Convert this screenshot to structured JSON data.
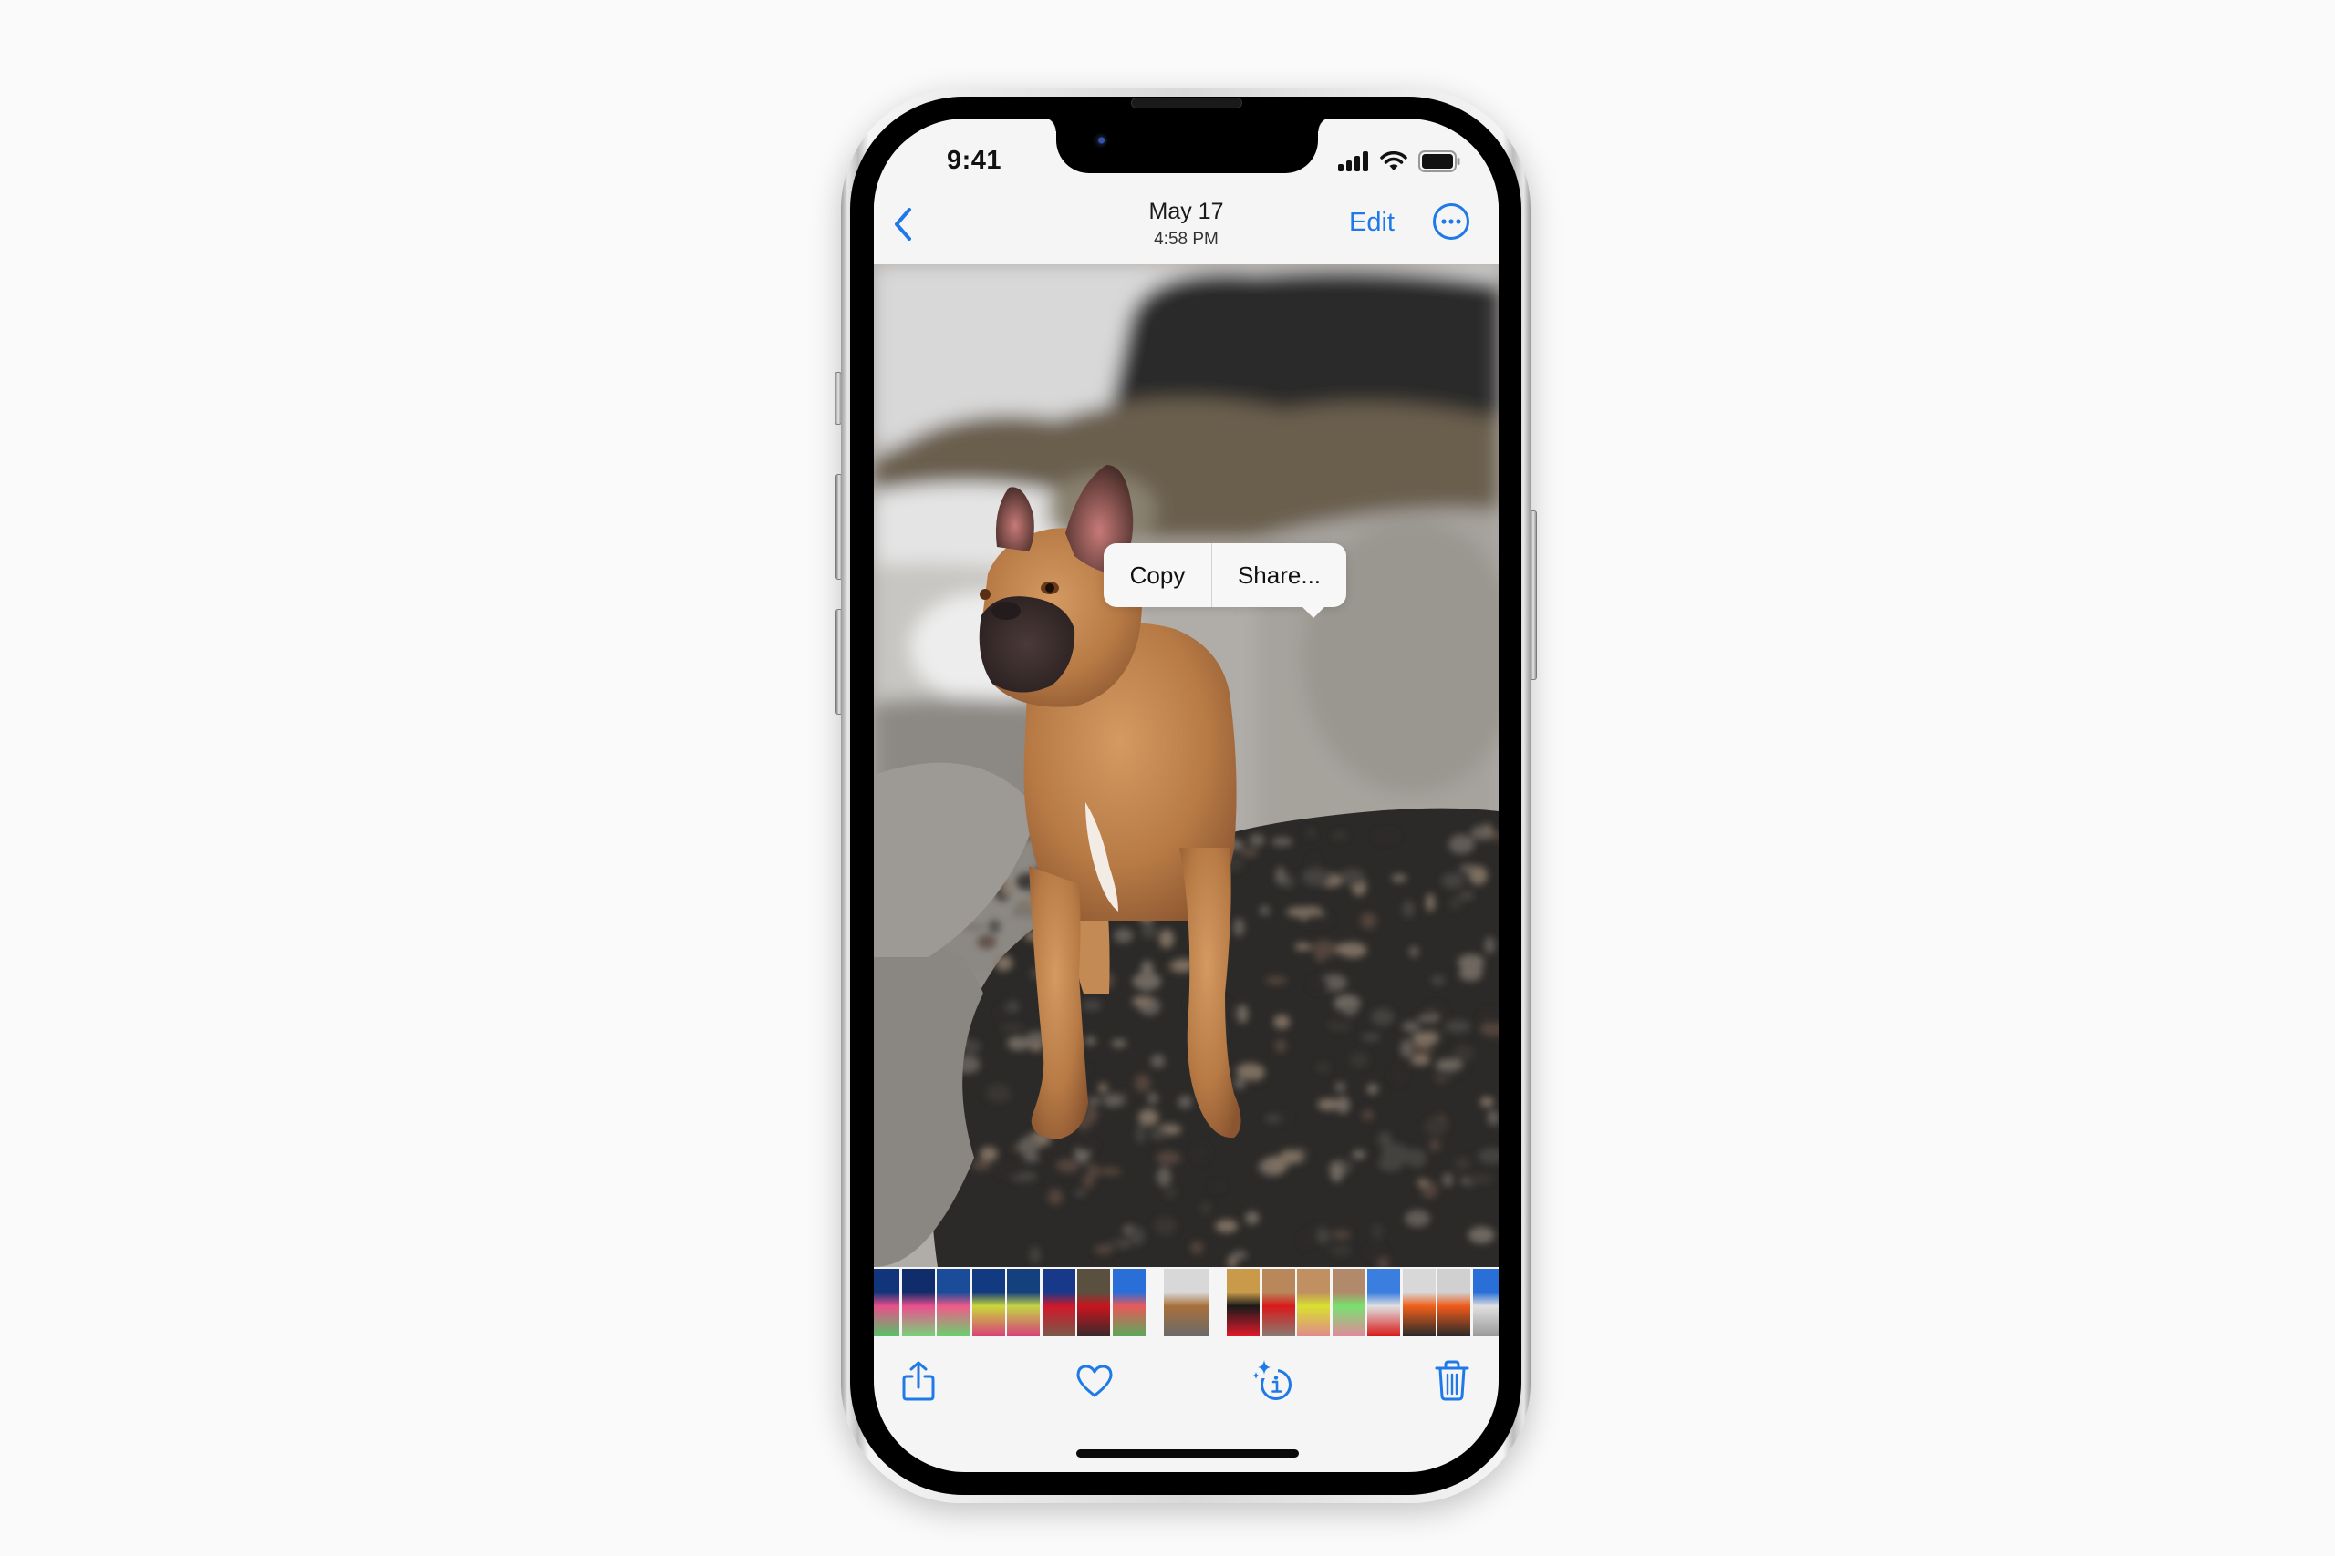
{
  "status_bar": {
    "time": "9:41",
    "signal_icon": "cellular-signal-icon",
    "wifi_icon": "wifi-icon",
    "battery_icon": "battery-icon"
  },
  "navbar": {
    "back_icon": "chevron-left-icon",
    "date": "May 17",
    "time": "4:58 PM",
    "edit_label": "Edit",
    "more_icon": "ellipsis-circle-icon"
  },
  "photo": {
    "subject": "French bulldog standing on pebble beach"
  },
  "context_menu": {
    "items": [
      {
        "label": "Copy"
      },
      {
        "label": "Share..."
      }
    ]
  },
  "thumbnail_strip": {
    "left": [
      {
        "colors": [
          "#12347a",
          "#e8508a",
          "#58c26a"
        ]
      },
      {
        "colors": [
          "#102c6a",
          "#ea4f8e",
          "#7ad17a"
        ]
      },
      {
        "colors": [
          "#1a4c9a",
          "#f05a8a",
          "#6ad06e"
        ]
      },
      {
        "colors": [
          "#123a80",
          "#c9d83a",
          "#d8407a"
        ]
      },
      {
        "colors": [
          "#15407e",
          "#c4d446",
          "#d6407a"
        ]
      },
      {
        "colors": [
          "#18388a",
          "#d0182a",
          "#7a5a4a"
        ]
      },
      {
        "colors": [
          "#5a5040",
          "#c8141e",
          "#3a2a2a"
        ]
      },
      {
        "colors": [
          "#2a6ed8",
          "#e85a5a",
          "#5aa85a"
        ]
      }
    ],
    "selected": {
      "colors": [
        "#d8d8d8",
        "#a8703a",
        "#6a6a6a"
      ]
    },
    "right": [
      {
        "colors": [
          "#c89a4a",
          "#1a1a1a",
          "#e01a2a"
        ]
      },
      {
        "colors": [
          "#b8885a",
          "#d81a1a",
          "#8a7a70"
        ]
      },
      {
        "colors": [
          "#c09060",
          "#d8e030",
          "#e08a8a"
        ]
      },
      {
        "colors": [
          "#b08a6a",
          "#7ae070",
          "#e08a9a"
        ]
      },
      {
        "colors": [
          "#3a7ee0",
          "#e0e0e0",
          "#d81a1a"
        ]
      },
      {
        "colors": [
          "#d8d8d8",
          "#f0601a",
          "#2a2a2a"
        ]
      },
      {
        "colors": [
          "#d0d0d0",
          "#f05a1a",
          "#2a2a2a"
        ]
      },
      {
        "colors": [
          "#2a6ed8",
          "#e0e0e0",
          "#9a9a9a"
        ]
      }
    ]
  },
  "toolbar": {
    "items": [
      {
        "icon": "share-icon",
        "label": "Share"
      },
      {
        "icon": "heart-icon",
        "label": "Favorite"
      },
      {
        "icon": "info-sparkle-icon",
        "label": "Info"
      },
      {
        "icon": "trash-icon",
        "label": "Delete"
      }
    ]
  },
  "colors": {
    "accent": "#1f7ae8",
    "background": "#fafafa",
    "bar_background": "#f5f5f5"
  }
}
